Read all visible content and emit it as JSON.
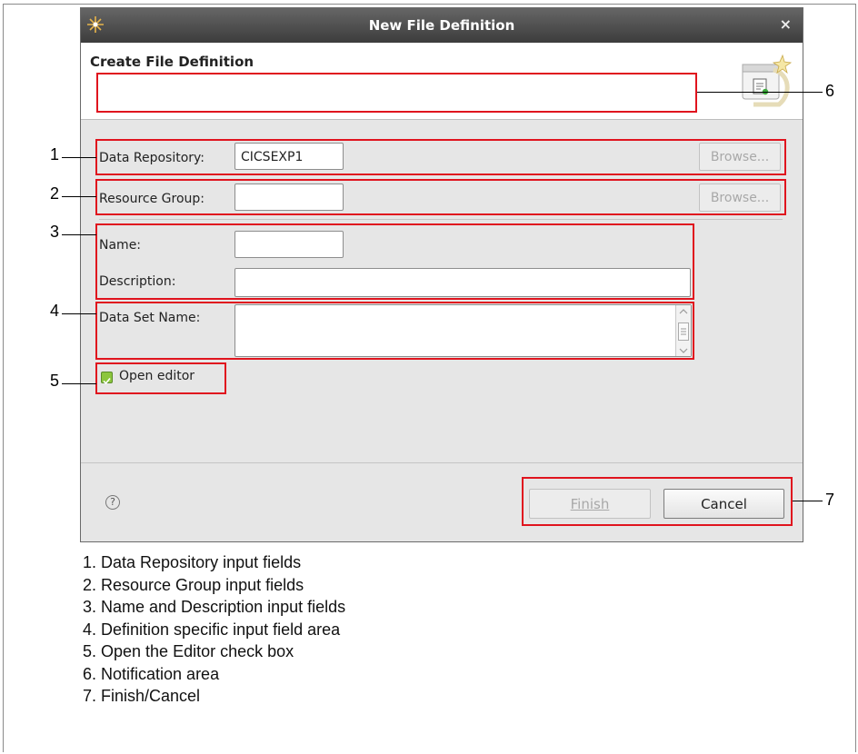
{
  "dialog": {
    "title": "New File Definition",
    "close_glyph": "×",
    "header_title": "Create File Definition",
    "data_repository": {
      "label": "Data Repository:",
      "value": "CICSEXP1",
      "browse_label": "Browse..."
    },
    "resource_group": {
      "label": "Resource Group:",
      "value": "",
      "browse_label": "Browse..."
    },
    "name": {
      "label": "Name:",
      "value": ""
    },
    "description": {
      "label": "Description:",
      "value": ""
    },
    "data_set_name": {
      "label": "Data Set Name:",
      "value": ""
    },
    "open_editor": {
      "label": "Open editor",
      "checked": true
    },
    "help_glyph": "?",
    "finish_label": "Finish",
    "cancel_label": "Cancel"
  },
  "callouts": [
    "1",
    "2",
    "3",
    "4",
    "5",
    "6",
    "7"
  ],
  "legend": [
    "1. Data Repository input fields",
    "2. Resource Group input fields",
    "3. Name and Description input fields",
    "4. Definition specific input field area",
    "5. Open the Editor check box",
    "6. Notification area",
    "7. Finish/Cancel"
  ],
  "colors": {
    "highlight": "#e0141e",
    "titlebar": "#4a4a4a",
    "dialog_bg": "#e6e6e6"
  }
}
